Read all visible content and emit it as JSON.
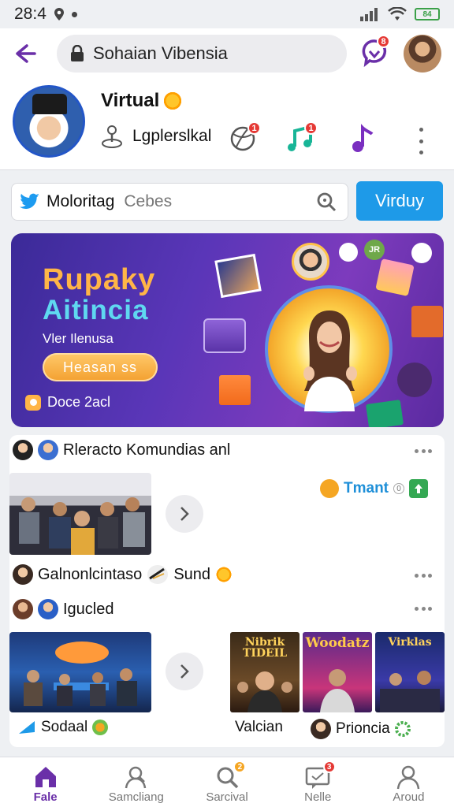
{
  "status_bar": {
    "time": "28:4",
    "battery_label": "84"
  },
  "header": {
    "search_text": "Sohaian Vibensia",
    "messages_badge": "8",
    "profile_name": "Virtual",
    "profile_subtitle": "Lgplerslkal",
    "icon_badges": [
      "1",
      "1"
    ]
  },
  "search": {
    "value": "Moloritag",
    "placeholder": "Cebes",
    "button_label": "Virduy"
  },
  "banner": {
    "title_line1": "Rupaky",
    "title_line2": "Aitincia",
    "subtitle": "Vler Ilenusa",
    "button_label": "Heasan ss",
    "footer": "Doce 2acl",
    "sticker_label": "JR"
  },
  "feed": {
    "section1_title": "Rleracto Komundias anl",
    "tmant_label": "Tmant",
    "tmant_count": "0",
    "row2_name": "Galnonlcintaso",
    "row2_tag": "Sund",
    "row3_name": "Igucled",
    "posters": [
      {
        "title": "Nibrik TIDEIL"
      },
      {
        "title": "Woodatz"
      },
      {
        "title": "Virklas"
      }
    ],
    "bottom_left": "Sodaal",
    "bottom_mid": "Valcian",
    "bottom_right": "Prioncia"
  },
  "nav": {
    "items": [
      {
        "label": "Fale",
        "icon": "home-icon",
        "active": true
      },
      {
        "label": "Samcliang",
        "icon": "profile-search-icon"
      },
      {
        "label": "Sarcival",
        "icon": "search-icon",
        "badge": "2"
      },
      {
        "label": "Nelle",
        "icon": "message-icon",
        "badge": "3"
      },
      {
        "label": "Aroud",
        "icon": "person-icon"
      }
    ]
  },
  "colors": {
    "accent": "#6a2fa8",
    "primary_button": "#1e9ae8",
    "badge": "#e53935"
  }
}
